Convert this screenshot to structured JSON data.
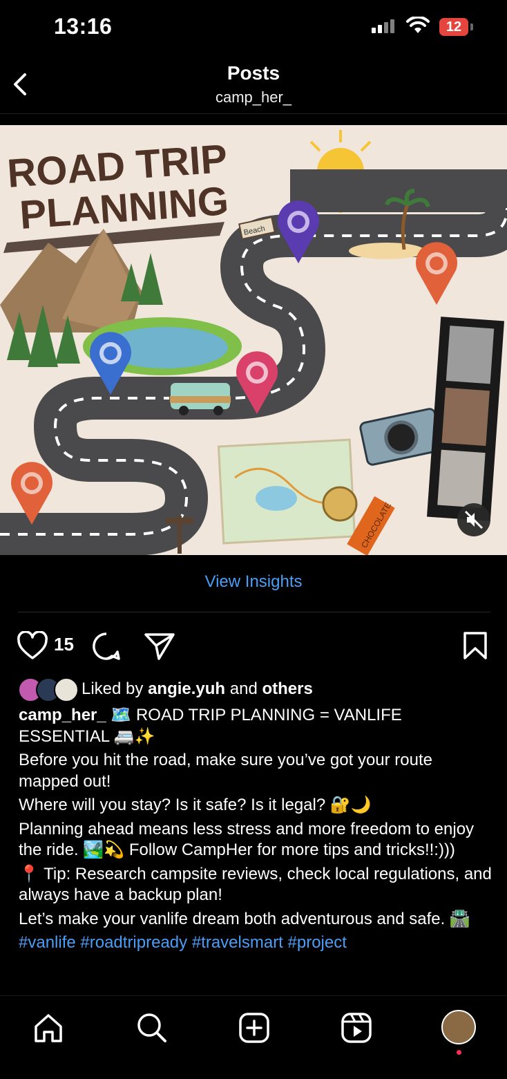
{
  "status_bar": {
    "time": "13:16",
    "battery": "12"
  },
  "header": {
    "title": "Posts",
    "subtitle": "camp_her_"
  },
  "post": {
    "image_title_line1": "ROAD TRIP",
    "image_title_line2": "PLANNING",
    "sign_text": "Beach",
    "chocolate_text": "CHOCOLATE",
    "view_insights": "View Insights",
    "like_count": "15",
    "liked_by_prefix": "Liked by",
    "liked_by_user": "angie.yuh",
    "liked_by_and": "and",
    "liked_by_others": "others",
    "caption_user": "camp_her_",
    "caption_lines": [
      "🗺️ ROAD TRIP PLANNING = VANLIFE ESSENTIAL 🚐✨",
      "Before you hit the road, make sure you’ve got your route mapped out!",
      "Where will you stay? Is it safe? Is it legal? 🔐🌙",
      "Planning ahead means less stress and more freedom to enjoy the ride. 🏞️💫 Follow CampHer for more tips and tricks!!:)))",
      "📍 Tip: Research campsite reviews, check local regulations, and always have a backup plan!",
      "Let’s make your vanlife dream both adventurous and safe. 🛣️"
    ],
    "hashtags": "#vanlife #roadtripready #travelsmart #project"
  },
  "colors": {
    "link": "#4b9ef7",
    "background": "#000000",
    "image_bg": "#f0e6dc",
    "road": "#4a4a4c"
  }
}
